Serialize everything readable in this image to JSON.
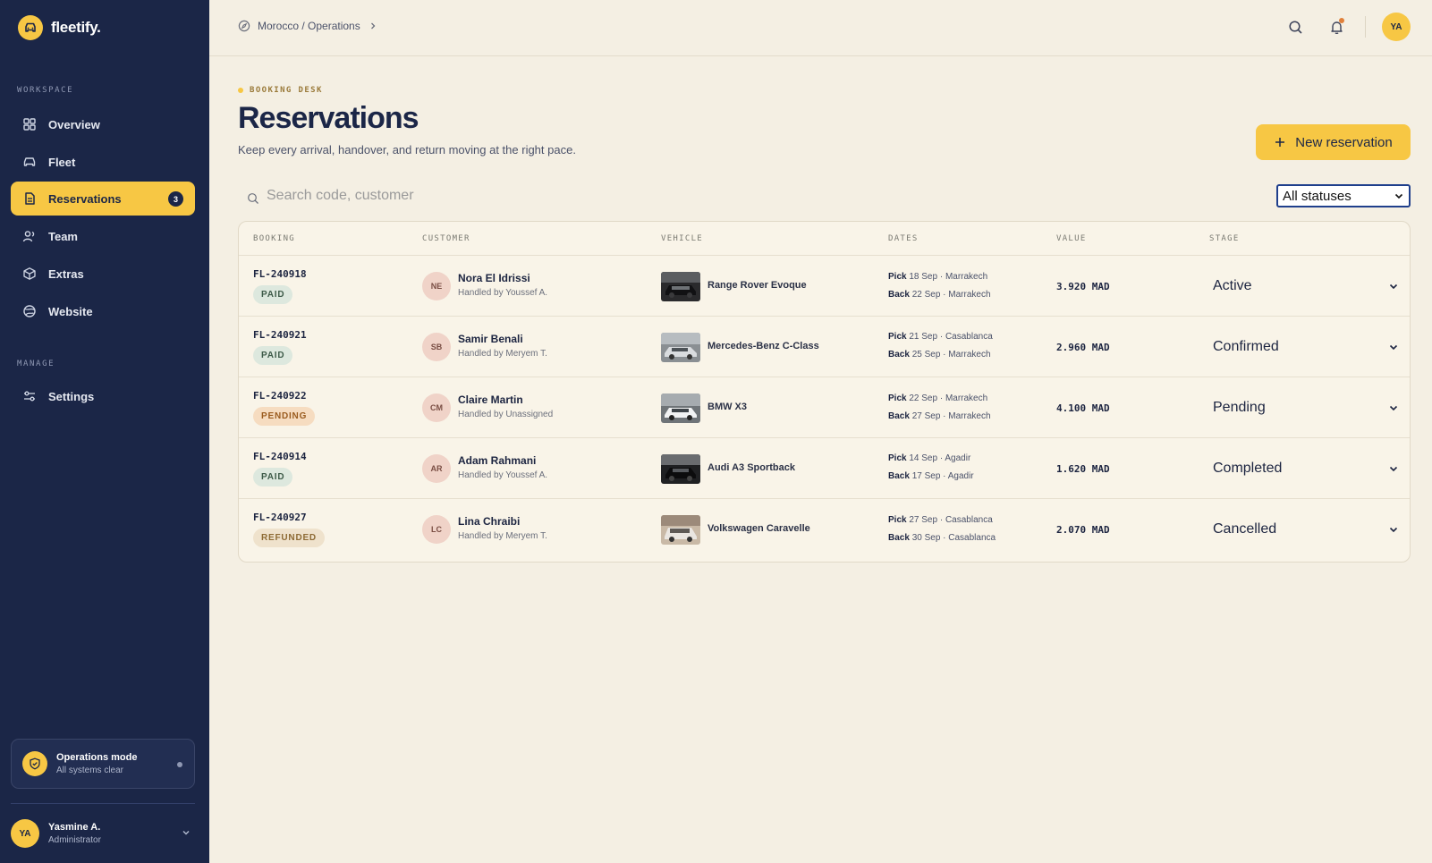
{
  "app": {
    "logo_text": "fleetify."
  },
  "sidebar": {
    "sections": {
      "workspace": "WORKSPACE",
      "manage": "MANAGE"
    },
    "items": [
      {
        "label": "Overview"
      },
      {
        "label": "Fleet"
      },
      {
        "label": "Reservations",
        "badge": "3"
      },
      {
        "label": "Team"
      },
      {
        "label": "Extras"
      },
      {
        "label": "Website"
      },
      {
        "label": "Settings"
      }
    ],
    "ops": {
      "title": "Operations mode",
      "subtitle": "All systems clear"
    },
    "user": {
      "initials": "YA",
      "name": "Yasmine A.",
      "role": "Administrator"
    }
  },
  "topbar": {
    "breadcrumb": "Morocco / Operations",
    "avatar_initials": "YA"
  },
  "header": {
    "eyebrow": "BOOKING DESK",
    "title": "Reservations",
    "subtitle": "Keep every arrival, handover, and return moving at the right pace.",
    "new_button": "New reservation"
  },
  "filters": {
    "search_placeholder": "Search code, customer",
    "status_selected": "All statuses"
  },
  "table": {
    "columns": [
      "BOOKING",
      "CUSTOMER",
      "VEHICLE",
      "DATES",
      "VALUE",
      "STAGE"
    ],
    "rows": [
      {
        "code": "FL-240918",
        "payment": "PAID",
        "initials": "NE",
        "customer": "Nora El Idrissi",
        "handler": "Handled by Youssef A.",
        "vehicle": "Range Rover Evoque",
        "pick_label": "Pick",
        "pick": "18 Sep · Marrakech",
        "back_label": "Back",
        "back": "22 Sep · Marrakech",
        "value": "3.920 MAD",
        "stage": "Active"
      },
      {
        "code": "FL-240921",
        "payment": "PAID",
        "initials": "SB",
        "customer": "Samir Benali",
        "handler": "Handled by Meryem T.",
        "vehicle": "Mercedes-Benz C-Class",
        "pick_label": "Pick",
        "pick": "21 Sep · Casablanca",
        "back_label": "Back",
        "back": "25 Sep · Marrakech",
        "value": "2.960 MAD",
        "stage": "Confirmed"
      },
      {
        "code": "FL-240922",
        "payment": "PENDING",
        "initials": "CM",
        "customer": "Claire Martin",
        "handler": "Handled by Unassigned",
        "vehicle": "BMW X3",
        "pick_label": "Pick",
        "pick": "22 Sep · Marrakech",
        "back_label": "Back",
        "back": "27 Sep · Marrakech",
        "value": "4.100 MAD",
        "stage": "Pending"
      },
      {
        "code": "FL-240914",
        "payment": "PAID",
        "initials": "AR",
        "customer": "Adam Rahmani",
        "handler": "Handled by Youssef A.",
        "vehicle": "Audi A3 Sportback",
        "pick_label": "Pick",
        "pick": "14 Sep · Agadir",
        "back_label": "Back",
        "back": "17 Sep · Agadir",
        "value": "1.620 MAD",
        "stage": "Completed"
      },
      {
        "code": "FL-240927",
        "payment": "REFUNDED",
        "initials": "LC",
        "customer": "Lina Chraibi",
        "handler": "Handled by Meryem T.",
        "vehicle": "Volkswagen Caravelle",
        "pick_label": "Pick",
        "pick": "27 Sep · Casablanca",
        "back_label": "Back",
        "back": "30 Sep · Casablanca",
        "value": "2.070 MAD",
        "stage": "Cancelled"
      }
    ]
  },
  "colors": {
    "sidebar": "#1b2647",
    "accent": "#f7c744",
    "background": "#f4efe3"
  }
}
